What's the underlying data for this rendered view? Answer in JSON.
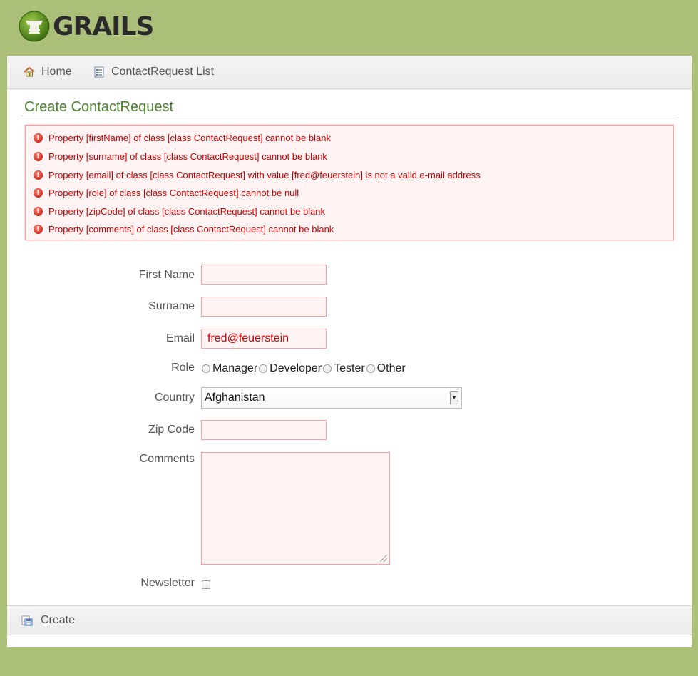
{
  "brand": {
    "name": "GRAILS"
  },
  "nav": {
    "home": "Home",
    "list": "ContactRequest List"
  },
  "page": {
    "title": "Create ContactRequest"
  },
  "errors": [
    "Property [firstName] of class [class ContactRequest] cannot be blank",
    "Property [surname] of class [class ContactRequest] cannot be blank",
    "Property [email] of class [class ContactRequest] with value [fred@feuerstein] is not a valid e-mail address",
    "Property [role] of class [class ContactRequest] cannot be null",
    "Property [zipCode] of class [class ContactRequest] cannot be blank",
    "Property [comments] of class [class ContactRequest] cannot be blank"
  ],
  "form": {
    "first_name": {
      "label": "First Name",
      "value": ""
    },
    "surname": {
      "label": "Surname",
      "value": ""
    },
    "email": {
      "label": "Email",
      "value": "fred@feuerstein"
    },
    "role": {
      "label": "Role",
      "options": [
        "Manager",
        "Developer",
        "Tester",
        "Other"
      ]
    },
    "country": {
      "label": "Country",
      "value": "Afghanistan"
    },
    "zip_code": {
      "label": "Zip Code",
      "value": ""
    },
    "comments": {
      "label": "Comments",
      "value": ""
    },
    "newsletter": {
      "label": "Newsletter",
      "checked": false
    }
  },
  "actions": {
    "create": "Create"
  },
  "colors": {
    "brand_green": "#abbf78",
    "title_green": "#48802c",
    "error_red": "#cc0000",
    "error_bg": "#fff3f3"
  }
}
